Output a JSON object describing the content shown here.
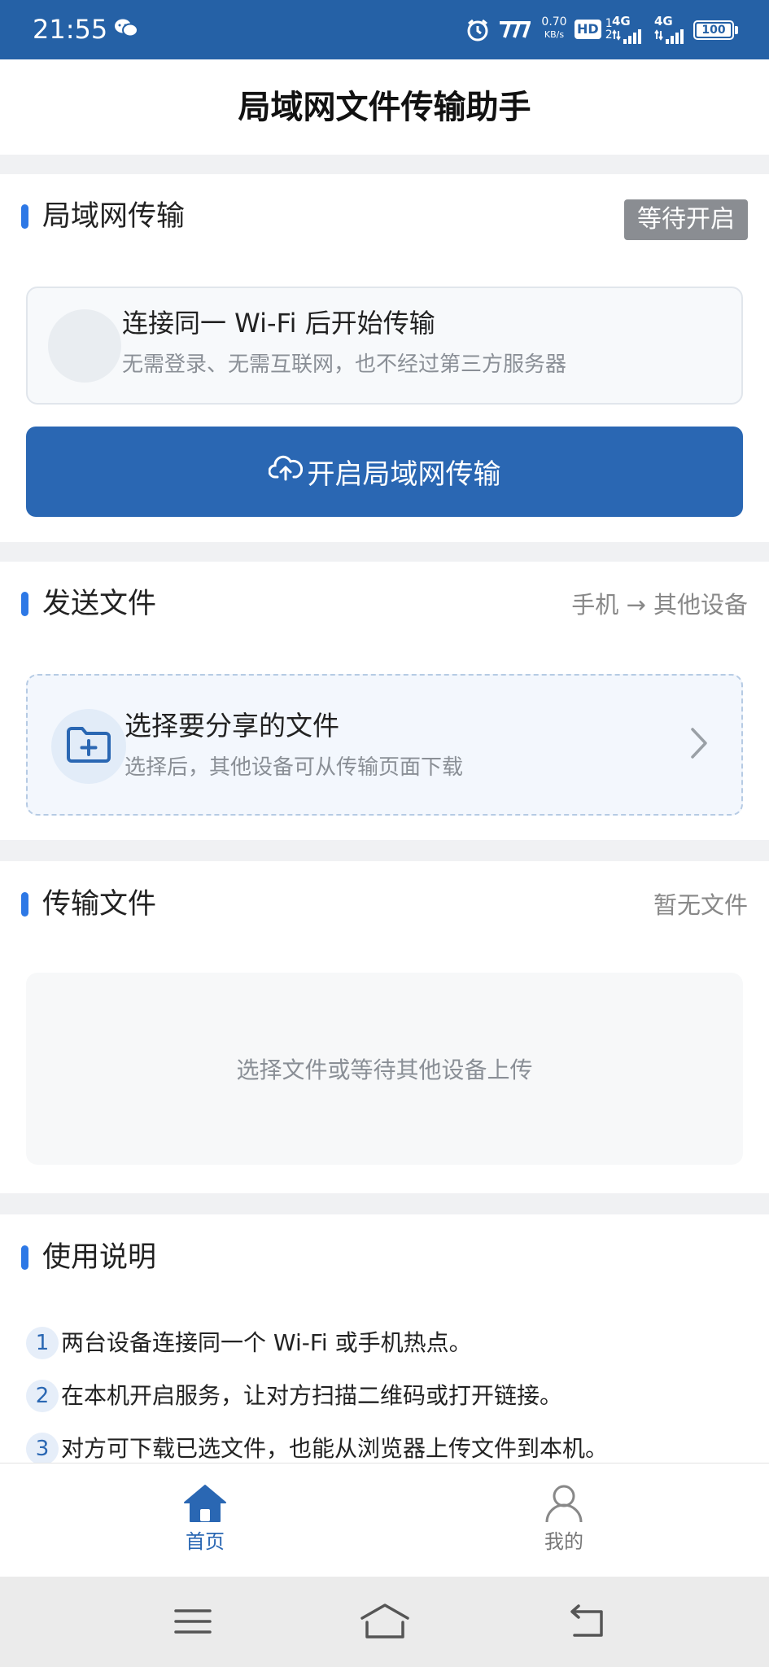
{
  "status_bar": {
    "time": "21:55",
    "net_speed_value": "0.70",
    "net_speed_unit": "KB/s",
    "hd_label": "HD",
    "sim1_label": "1",
    "sim2_label": "2",
    "signal1_label": "4G",
    "signal2_label": "4G",
    "battery": "100",
    "icons": [
      "wechat-icon",
      "alarm-icon",
      "nfc-icon",
      "hd-voice-icon",
      "signal-icon",
      "battery-icon"
    ]
  },
  "header": {
    "title": "局域网文件传输助手"
  },
  "lan_section": {
    "title": "局域网传输",
    "status_badge": "等待开启",
    "info_title": "连接同一 Wi-Fi 后开始传输",
    "info_subtitle": "无需登录、无需互联网，也不经过第三方服务器",
    "button_label": "开启局域网传输"
  },
  "send_section": {
    "title": "发送文件",
    "direction": "手机 → 其他设备",
    "pick_title": "选择要分享的文件",
    "pick_subtitle": "选择后，其他设备可从传输页面下载"
  },
  "transfer_section": {
    "title": "传输文件",
    "status": "暂无文件",
    "empty_text": "选择文件或等待其他设备上传"
  },
  "guide_section": {
    "title": "使用说明",
    "steps": [
      {
        "num": "1",
        "text": "两台设备连接同一个 Wi-Fi 或手机热点。"
      },
      {
        "num": "2",
        "text": "在本机开启服务，让对方扫描二维码或打开链接。"
      },
      {
        "num": "3",
        "text": "对方可下载已选文件，也能从浏览器上传文件到本机。"
      }
    ]
  },
  "bottom_nav": {
    "items": [
      {
        "label": "首页",
        "icon": "home-icon",
        "active": true
      },
      {
        "label": "我的",
        "icon": "user-icon",
        "active": false
      }
    ]
  },
  "colors": {
    "status_bar": "#2561a6",
    "primary": "#2a67b3",
    "accent_bar": "#2d78e6",
    "badge_bg": "#8a8d92",
    "nav_active": "#2a67b3",
    "nav_inactive": "#777777"
  }
}
